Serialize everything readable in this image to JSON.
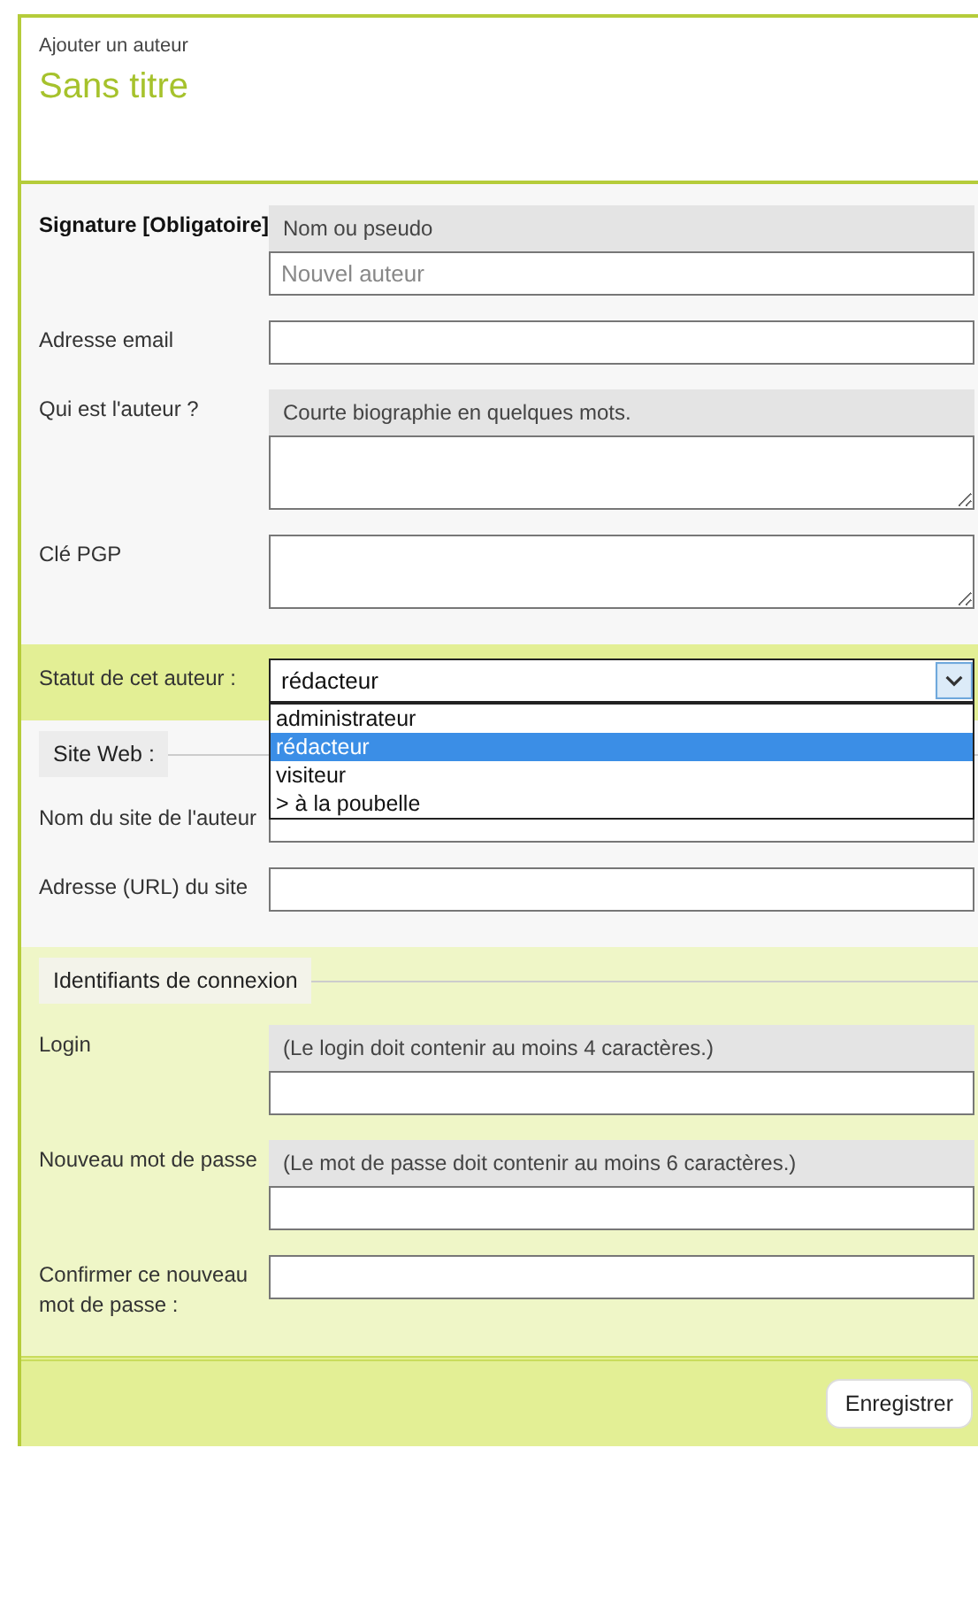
{
  "header": {
    "subtitle": "Ajouter un auteur",
    "title": "Sans titre"
  },
  "sections": [
    {
      "kind": "plain",
      "fields": [
        {
          "kind": "input",
          "label": "Signature [Obligatoire]",
          "required": true,
          "hint": "Nom ou pseudo",
          "placeholder": "Nouvel auteur"
        },
        {
          "kind": "input",
          "label": "Adresse email",
          "required": false
        },
        {
          "kind": "textarea",
          "label": "Qui est l'auteur ?",
          "required": false,
          "hint": "Courte biographie en quelques mots."
        },
        {
          "kind": "textarea",
          "label": "Clé PGP",
          "required": false
        }
      ]
    },
    {
      "kind": "status",
      "fields": [
        {
          "kind": "select",
          "label": "Statut de cet auteur :",
          "required": false,
          "value": "rédacteur",
          "open": true,
          "options": [
            {
              "label": "administrateur",
              "selected": false
            },
            {
              "label": "rédacteur",
              "selected": true
            },
            {
              "label": "visiteur",
              "selected": false
            },
            {
              "label": "> à la poubelle",
              "selected": false
            }
          ]
        }
      ]
    },
    {
      "kind": "fieldset",
      "legend": "Site Web :",
      "fields": [
        {
          "kind": "input",
          "label": "Nom du site de l'auteur",
          "required": false
        },
        {
          "kind": "input",
          "label": "Adresse (URL) du site",
          "required": false
        }
      ]
    },
    {
      "kind": "fieldset_green",
      "legend": "Identifiants de connexion",
      "fields": [
        {
          "kind": "input",
          "label": "Login",
          "required": false,
          "hint": "(Le login doit contenir au moins 4 caractères.)"
        },
        {
          "kind": "input",
          "label": "Nouveau mot de passe",
          "required": false,
          "hint": "(Le mot de passe doit contenir au moins 6 caractères.)"
        },
        {
          "kind": "input",
          "label": "Confirmer ce nouveau mot de passe :",
          "required": false
        }
      ]
    }
  ],
  "submit": "Enregistrer"
}
